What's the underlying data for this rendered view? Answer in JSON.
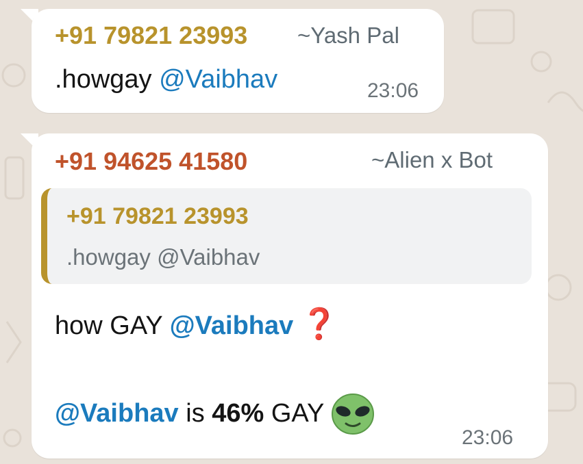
{
  "messages": [
    {
      "sender": "+91 79821 23993",
      "alias": "~Yash Pal",
      "text": ".howgay",
      "mention": "@Vaibhav",
      "time": "23:06"
    },
    {
      "sender": "+91 94625 41580",
      "alias": "~Alien x Bot",
      "quote": {
        "sender": "+91 79821 23993",
        "text": ".howgay @Vaibhav"
      },
      "line1_prefix": "how GAY ",
      "line1_mention": "@Vaibhav",
      "line1_emoji": "❓",
      "line2_mention": "@Vaibhav",
      "line2_is": " is ",
      "line2_percent": "46%",
      "line2_suffix": " GAY ",
      "line2_icon": "alien-face-icon",
      "time": "23:06"
    }
  ],
  "colors": {
    "wallpaper": "#e9e2da",
    "sender1": "#b8932c",
    "sender2": "#c0532b",
    "mention": "#1b7bbd",
    "quote_bar": "#b8932c"
  }
}
